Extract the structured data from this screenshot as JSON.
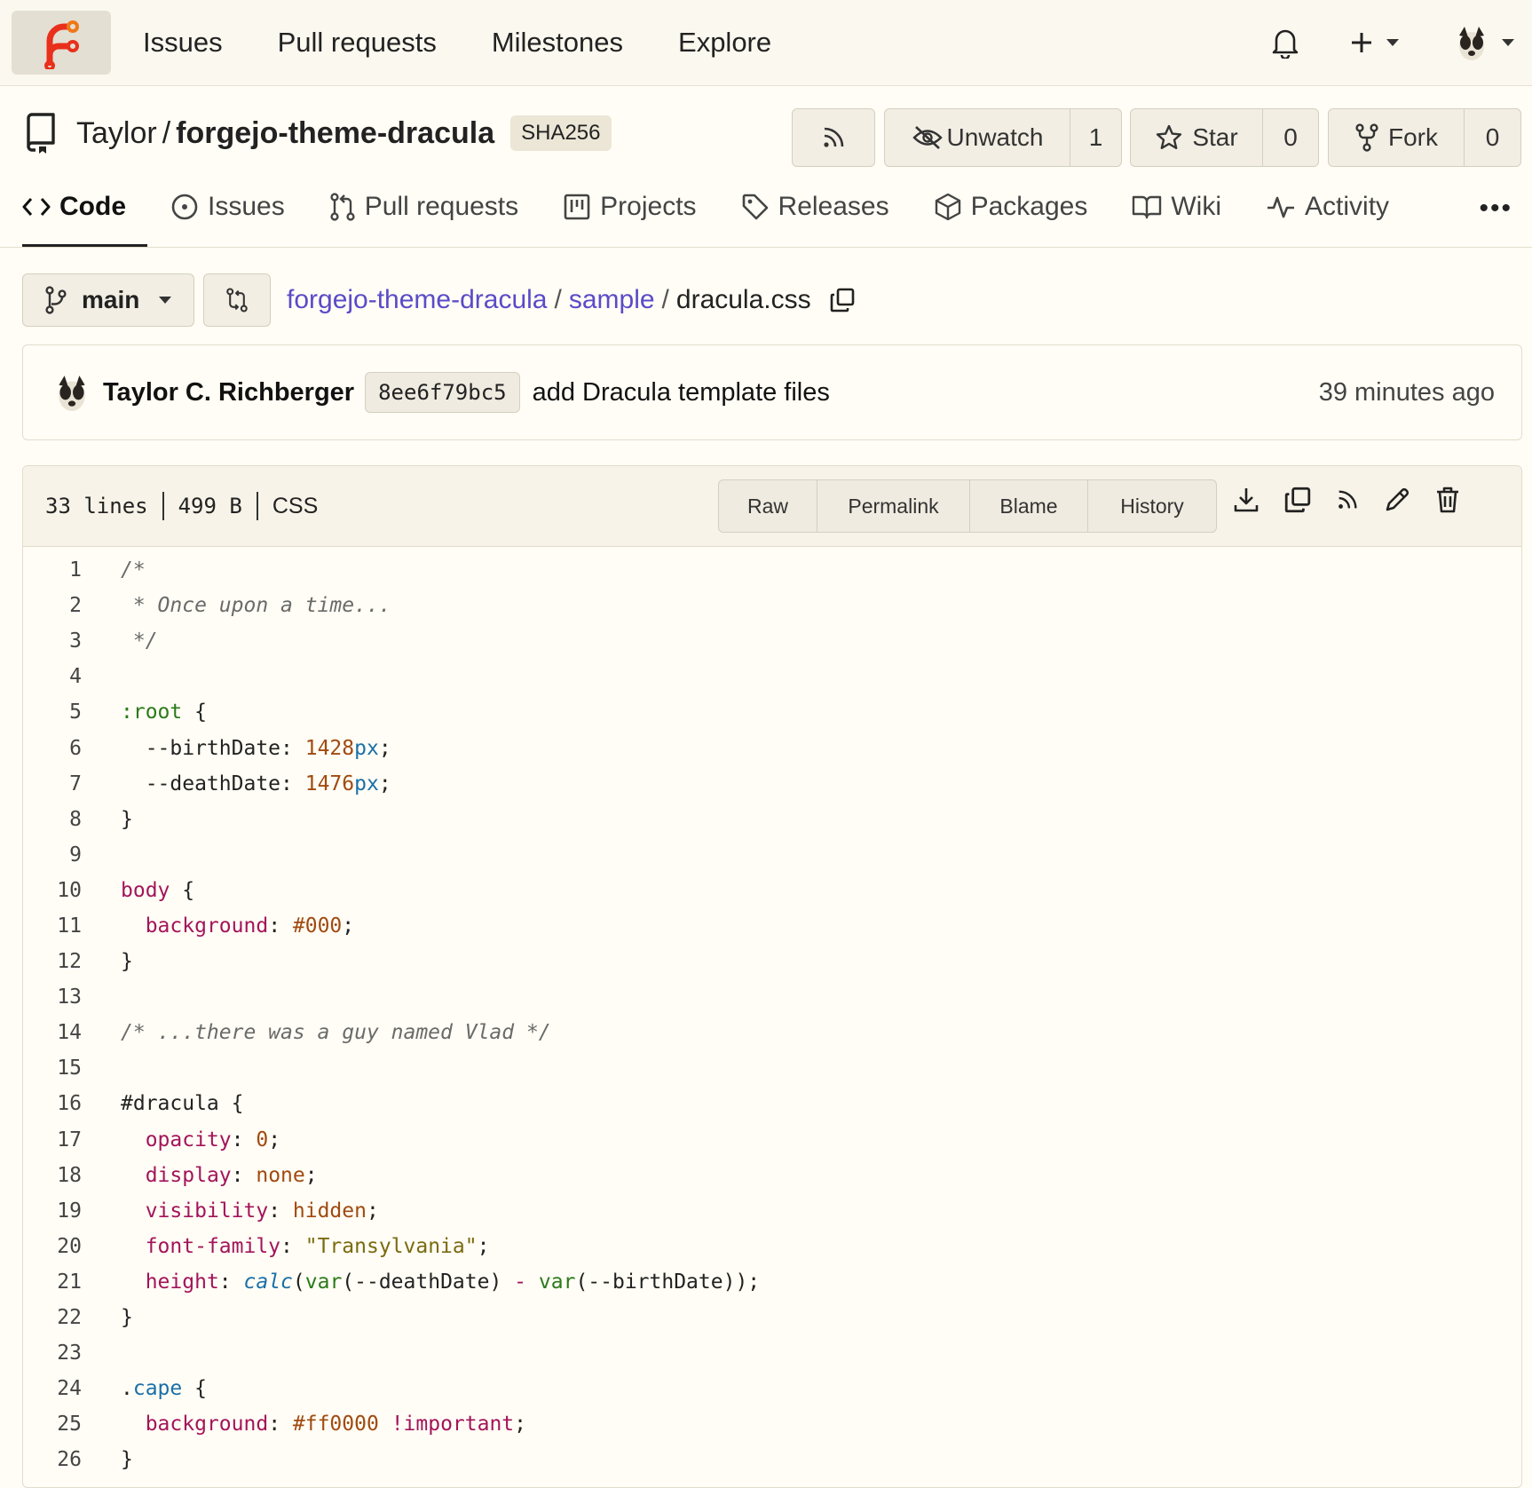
{
  "nav": {
    "links": [
      "Issues",
      "Pull requests",
      "Milestones",
      "Explore"
    ]
  },
  "repo": {
    "owner": "Taylor",
    "separator": "/",
    "name": "forgejo-theme-dracula",
    "hash_badge": "SHA256",
    "unwatch_label": "Unwatch",
    "watch_count": "1",
    "star_label": "Star",
    "star_count": "0",
    "fork_label": "Fork",
    "fork_count": "0"
  },
  "tabs": [
    {
      "label": "Code",
      "icon": "code-icon"
    },
    {
      "label": "Issues",
      "icon": "issue-icon"
    },
    {
      "label": "Pull requests",
      "icon": "pull-request-icon"
    },
    {
      "label": "Projects",
      "icon": "project-icon"
    },
    {
      "label": "Releases",
      "icon": "tag-icon"
    },
    {
      "label": "Packages",
      "icon": "package-icon"
    },
    {
      "label": "Wiki",
      "icon": "book-icon"
    },
    {
      "label": "Activity",
      "icon": "pulse-icon"
    }
  ],
  "branch": {
    "name": "main"
  },
  "breadcrumb": {
    "repo": "forgejo-theme-dracula",
    "folder": "sample",
    "file": "dracula.css"
  },
  "commit": {
    "author": "Taylor C. Richberger",
    "sha": "8ee6f79bc5",
    "message": "add Dracula template files",
    "time": "39 minutes ago"
  },
  "file": {
    "lines": "33 lines",
    "size": "499 B",
    "language": "CSS",
    "actions": [
      "Raw",
      "Permalink",
      "Blame",
      "History"
    ]
  },
  "code_lines": [
    [
      {
        "t": "/*",
        "c": "com"
      }
    ],
    [
      {
        "t": " * Once upon a time...",
        "c": "com"
      }
    ],
    [
      {
        "t": " */",
        "c": "com"
      }
    ],
    [],
    [
      {
        "t": ":root",
        "c": "sel"
      },
      {
        "t": " {",
        "c": ""
      }
    ],
    [
      {
        "t": "  --birthDate: ",
        "c": ""
      },
      {
        "t": "1428",
        "c": "num"
      },
      {
        "t": "px",
        "c": "unit"
      },
      {
        "t": ";",
        "c": ""
      }
    ],
    [
      {
        "t": "  --deathDate: ",
        "c": ""
      },
      {
        "t": "1476",
        "c": "num"
      },
      {
        "t": "px",
        "c": "unit"
      },
      {
        "t": ";",
        "c": ""
      }
    ],
    [
      {
        "t": "}",
        "c": ""
      }
    ],
    [],
    [
      {
        "t": "body",
        "c": "tag"
      },
      {
        "t": " {",
        "c": ""
      }
    ],
    [
      {
        "t": "  ",
        "c": ""
      },
      {
        "t": "background",
        "c": "prop"
      },
      {
        "t": ": ",
        "c": ""
      },
      {
        "t": "#000",
        "c": "num"
      },
      {
        "t": ";",
        "c": ""
      }
    ],
    [
      {
        "t": "}",
        "c": ""
      }
    ],
    [],
    [
      {
        "t": "/* ...there was a guy named Vlad */",
        "c": "com"
      }
    ],
    [],
    [
      {
        "t": "#dracula {",
        "c": ""
      }
    ],
    [
      {
        "t": "  ",
        "c": ""
      },
      {
        "t": "opacity",
        "c": "prop"
      },
      {
        "t": ": ",
        "c": ""
      },
      {
        "t": "0",
        "c": "num"
      },
      {
        "t": ";",
        "c": ""
      }
    ],
    [
      {
        "t": "  ",
        "c": ""
      },
      {
        "t": "display",
        "c": "prop"
      },
      {
        "t": ": ",
        "c": ""
      },
      {
        "t": "none",
        "c": "num"
      },
      {
        "t": ";",
        "c": ""
      }
    ],
    [
      {
        "t": "  ",
        "c": ""
      },
      {
        "t": "visibility",
        "c": "prop"
      },
      {
        "t": ": ",
        "c": ""
      },
      {
        "t": "hidden",
        "c": "num"
      },
      {
        "t": ";",
        "c": ""
      }
    ],
    [
      {
        "t": "  ",
        "c": ""
      },
      {
        "t": "font-family",
        "c": "prop"
      },
      {
        "t": ": ",
        "c": ""
      },
      {
        "t": "\"Transylvania\"",
        "c": "str"
      },
      {
        "t": ";",
        "c": ""
      }
    ],
    [
      {
        "t": "  ",
        "c": ""
      },
      {
        "t": "height",
        "c": "prop"
      },
      {
        "t": ": ",
        "c": ""
      },
      {
        "t": "calc",
        "c": "fn"
      },
      {
        "t": "(",
        "c": ""
      },
      {
        "t": "var",
        "c": "var"
      },
      {
        "t": "(--deathDate) ",
        "c": ""
      },
      {
        "t": "-",
        "c": "prop"
      },
      {
        "t": " ",
        "c": ""
      },
      {
        "t": "var",
        "c": "var"
      },
      {
        "t": "(--birthDate));",
        "c": ""
      }
    ],
    [
      {
        "t": "}",
        "c": ""
      }
    ],
    [],
    [
      {
        "t": ".",
        "c": ""
      },
      {
        "t": "cape",
        "c": "cls"
      },
      {
        "t": " {",
        "c": ""
      }
    ],
    [
      {
        "t": "  ",
        "c": ""
      },
      {
        "t": "background",
        "c": "prop"
      },
      {
        "t": ": ",
        "c": ""
      },
      {
        "t": "#ff0000",
        "c": "num"
      },
      {
        "t": " ",
        "c": ""
      },
      {
        "t": "!important",
        "c": "prop"
      },
      {
        "t": ";",
        "c": ""
      }
    ],
    [
      {
        "t": "}",
        "c": ""
      }
    ]
  ]
}
